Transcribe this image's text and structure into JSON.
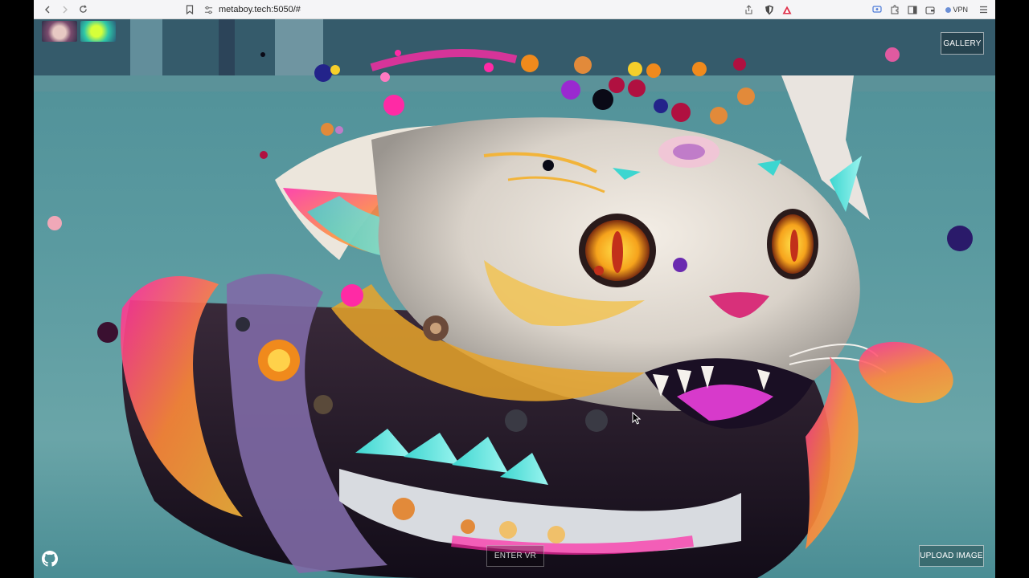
{
  "browser": {
    "url": "metaboy.tech:5050/#",
    "vpn_label": "VPN"
  },
  "page": {
    "gallery_label": "GALLERY",
    "upload_label": "UPLOAD IMAGE",
    "enter_vr_label": "ENTER VR"
  },
  "icons": {
    "back": "arrow-left-icon",
    "forward": "arrow-right-icon",
    "reload": "reload-icon",
    "bookmark": "bookmark-icon",
    "site_info": "tune-icon",
    "share": "share-icon",
    "brave_shield": "brave-shield-icon",
    "brave_rewards": "brave-rewards-icon",
    "github": "github-icon"
  },
  "colors": {
    "accent_pink": "#ff2aa5",
    "accent_teal": "#3dd6d0",
    "accent_gold": "#f2b43a"
  }
}
